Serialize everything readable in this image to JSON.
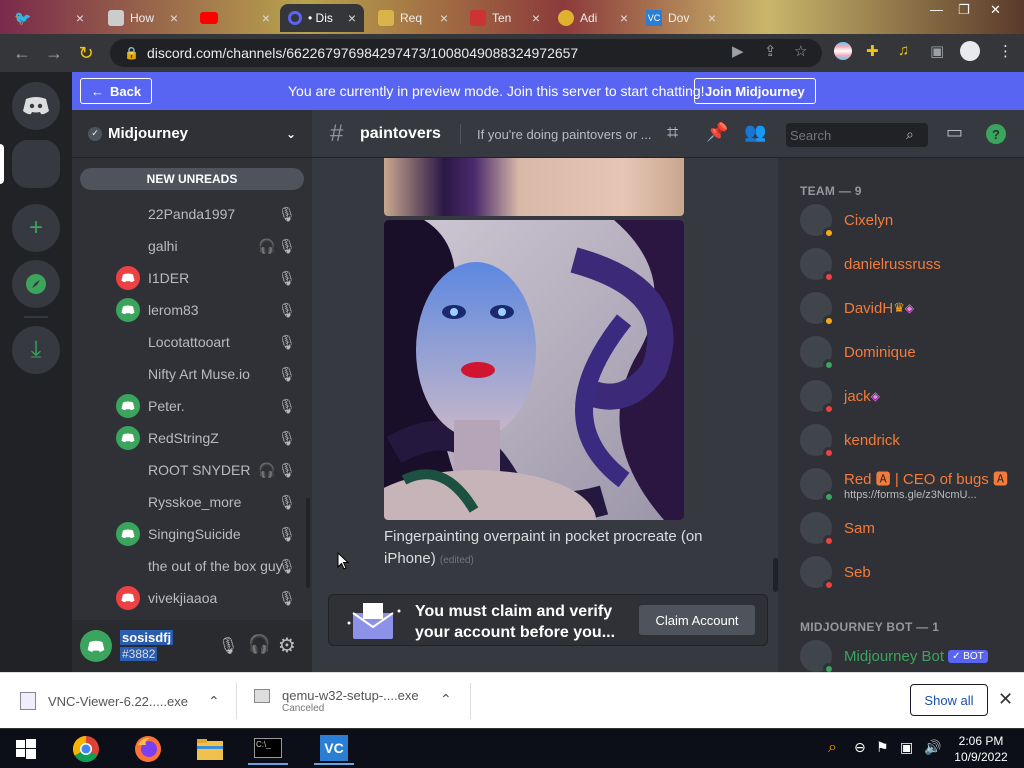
{
  "browser": {
    "tabs": [
      {
        "label": "",
        "icon": "twitter-icon"
      },
      {
        "label": "How",
        "icon": "tab-icon"
      },
      {
        "label": "",
        "icon": "youtube-icon"
      },
      {
        "label": "• Dis",
        "icon": "chrome-tab-icon"
      },
      {
        "label": "Req",
        "icon": "tab-icon"
      },
      {
        "label": "Ten",
        "icon": "tab-icon"
      },
      {
        "label": "Adi",
        "icon": "tab-icon"
      },
      {
        "label": "Dov",
        "icon": "vnc-icon"
      }
    ],
    "url": "discord.com/channels/662267976984297473/1008049088324972657"
  },
  "banner": {
    "back_label": "Back",
    "message": "You are currently in preview mode. Join this server to start chatting!",
    "join_label": "Join Midjourney"
  },
  "server": {
    "name": "Midjourney",
    "new_unreads": "NEW UNREADS"
  },
  "voice_users": [
    {
      "name": "22Panda1997",
      "avatar": "none",
      "deaf": false
    },
    {
      "name": "galhi",
      "avatar": "none",
      "deaf": true
    },
    {
      "name": "I1DER",
      "avatar": "red",
      "deaf": false
    },
    {
      "name": "lerom83",
      "avatar": "green",
      "deaf": false
    },
    {
      "name": "Locotattooart",
      "avatar": "none",
      "deaf": false
    },
    {
      "name": "Nifty Art Muse.io",
      "avatar": "none",
      "deaf": false
    },
    {
      "name": "Peter.",
      "avatar": "green",
      "deaf": false
    },
    {
      "name": "RedStringZ",
      "avatar": "green",
      "deaf": false
    },
    {
      "name": "ROOT SNYDER",
      "avatar": "none",
      "deaf": true
    },
    {
      "name": "Rysskoe_more",
      "avatar": "none",
      "deaf": false
    },
    {
      "name": "SingingSuicide",
      "avatar": "green",
      "deaf": false
    },
    {
      "name": "the out of the box guy",
      "avatar": "none",
      "deaf": false
    },
    {
      "name": "vivekjiaaoa",
      "avatar": "red",
      "deaf": false
    }
  ],
  "user_panel": {
    "username": "sosisdfj",
    "tag": "#3882"
  },
  "channel": {
    "name": "paintovers",
    "topic": "If you're doing paintovers or ...",
    "search_placeholder": "Search"
  },
  "message": {
    "text": "Fingerpainting overpaint in pocket procreate (on iPhone)",
    "edited": "(edited)"
  },
  "claim": {
    "text": "You must claim and verify your account before you...",
    "button": "Claim Account"
  },
  "members": {
    "team_header": "TEAM — 9",
    "team": [
      {
        "name": "Cixelyn",
        "status": "idle",
        "extra": ""
      },
      {
        "name": "danielrussruss",
        "status": "dnd",
        "extra": ""
      },
      {
        "name": "DavidH",
        "status": "idle",
        "extra": "crown"
      },
      {
        "name": "Dominique",
        "status": "online",
        "extra": ""
      },
      {
        "name": "jack",
        "status": "dnd",
        "extra": "boost"
      },
      {
        "name": "kendrick",
        "status": "dnd",
        "extra": ""
      },
      {
        "name": "Red 🅰 | CEO of bugs 🅰",
        "status": "online",
        "extra": "",
        "sub": "https://forms.gle/z3NcmU..."
      },
      {
        "name": "Sam",
        "status": "dnd",
        "extra": ""
      },
      {
        "name": "Seb",
        "status": "dnd",
        "extra": ""
      }
    ],
    "bot_header": "MIDJOURNEY BOT — 1",
    "bot": {
      "name": "Midjourney Bot",
      "badge": "✓ BOT"
    }
  },
  "downloads": {
    "items": [
      {
        "name": "VNC-Viewer-6.22.....exe",
        "status": ""
      },
      {
        "name": "qemu-w32-setup-....exe",
        "status": "Canceled"
      }
    ],
    "show_all": "Show all"
  },
  "taskbar": {
    "time": "2:06 PM",
    "date": "10/9/2022"
  },
  "colors": {
    "blurple": "#5865f2",
    "green": "#3ba55d",
    "red": "#ed4245",
    "idle": "#faa81a",
    "member_name": "#f47b3a",
    "bot_name": "#3ba55d"
  }
}
